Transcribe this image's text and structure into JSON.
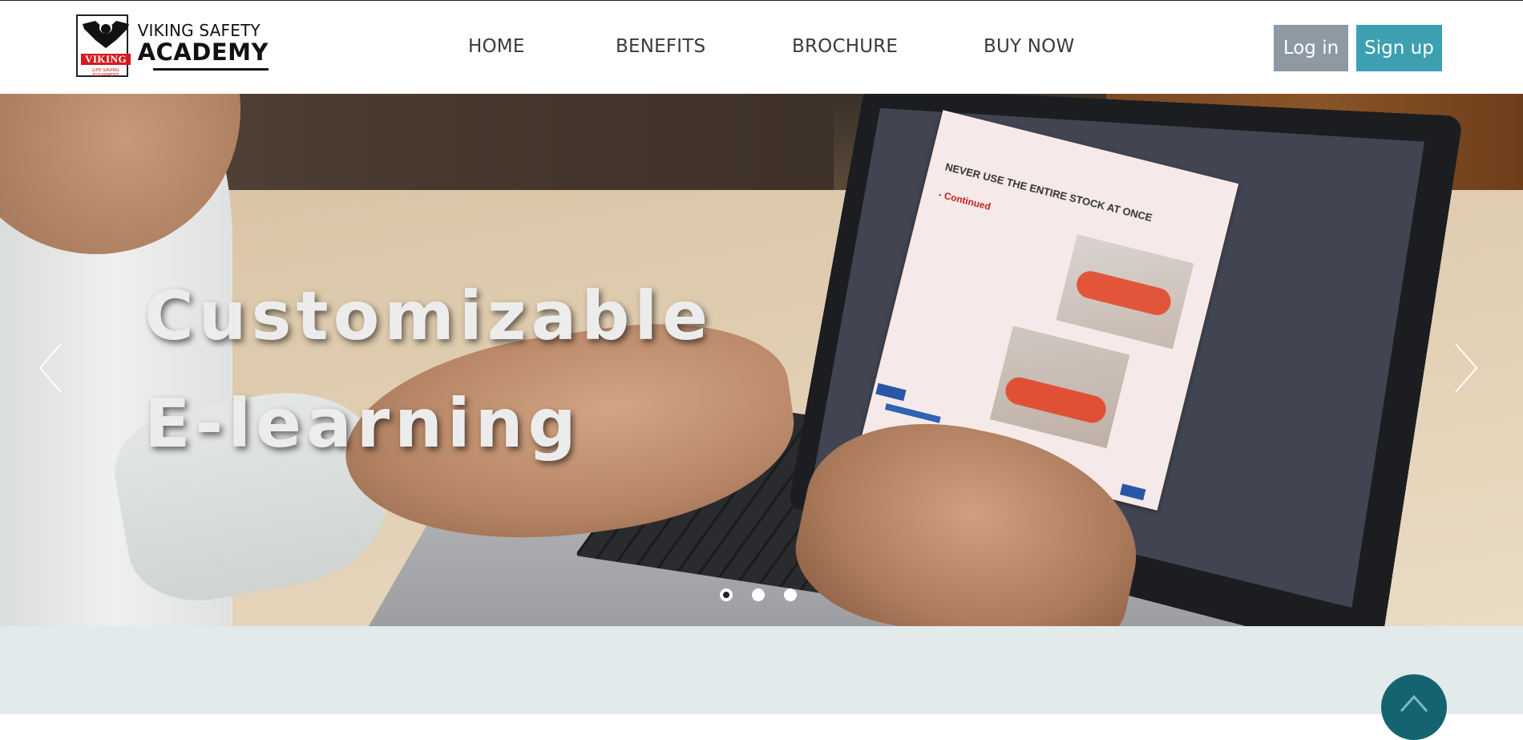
{
  "brand": {
    "logo_line1": "VIKING SAFETY",
    "logo_line2": "ACADEMY",
    "mark_text": "VIKING",
    "mark_tagline": "LIFE-SAVING EQUIPMENT"
  },
  "nav": {
    "items": [
      {
        "label": "HOME"
      },
      {
        "label": "BENEFITS"
      },
      {
        "label": "BROCHURE"
      },
      {
        "label": "BUY NOW"
      }
    ],
    "login_label": "Log in",
    "signup_label": "Sign up"
  },
  "hero": {
    "title_line1": "Customizable",
    "title_line2": "E-learning",
    "slide_count": 3,
    "active_slide": 1,
    "screen_slide": {
      "title": "NEVER USE THE ENTIRE STOCK AT ONCE",
      "subtitle": "- Continued"
    }
  },
  "colors": {
    "login_bg": "#8e99a3",
    "signup_bg": "#3d9fb0",
    "band_bg": "#e3eaec",
    "scroll_top_bg": "#136470",
    "brand_red": "#d71920"
  },
  "icons": {
    "prev": "chevron-left-icon",
    "next": "chevron-right-icon",
    "scroll_top": "chevron-up-icon"
  }
}
